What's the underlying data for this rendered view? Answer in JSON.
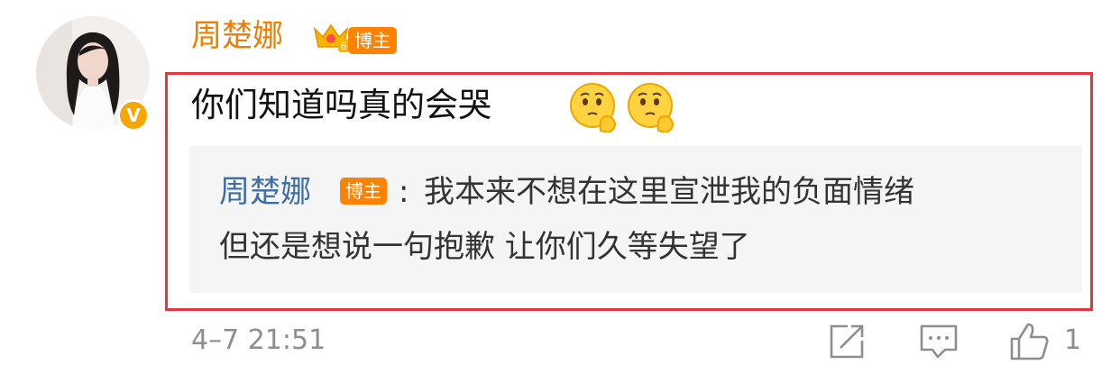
{
  "comment": {
    "user": {
      "name": "周楚娜",
      "badge": "博主",
      "verified_mark": "V"
    },
    "text": "你们知道吗真的会哭",
    "emojis": [
      "thinking-face-icon",
      "thinking-face-icon"
    ],
    "quote": {
      "name": "周楚娜",
      "badge": "博主",
      "separator": ":",
      "line1": "我本来不想在这里宣泄我的负面情绪",
      "line2": "但还是想说一句抱歉 让你们久等失望了"
    },
    "timestamp": "4–7 21:51",
    "actions": {
      "share_icon": "share-icon",
      "comment_icon": "comment-icon",
      "like_icon": "thumbs-up-icon",
      "like_count": "1"
    }
  },
  "colors": {
    "username": "#ef7d00",
    "badge": "#ff8200",
    "quote_name": "#3d6ea5",
    "highlight_border": "#e8343b",
    "meta": "#8e8e8e"
  }
}
